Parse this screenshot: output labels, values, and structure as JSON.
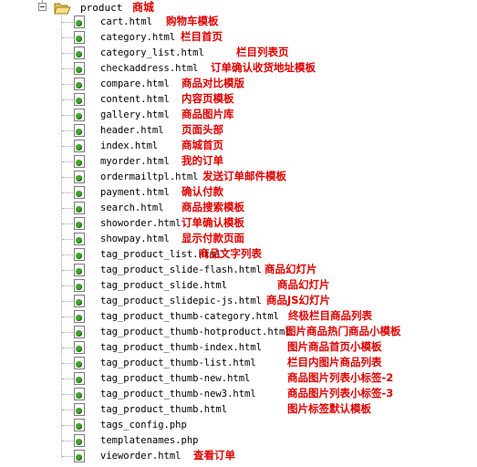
{
  "root": {
    "name": "product",
    "desc": "商城",
    "icon": "folder-open-icon",
    "toggle": "minus"
  },
  "colors": {
    "desc": "#e00000",
    "name": "#000000"
  },
  "files": [
    {
      "name": "cart.html",
      "desc": "购物车模板"
    },
    {
      "name": "category.html",
      "desc": "栏目首页"
    },
    {
      "name": "category_list.html",
      "desc": "栏目列表页"
    },
    {
      "name": "checkaddress.html",
      "desc": "订单确认收货地址模板"
    },
    {
      "name": "compare.html",
      "desc": "商品对比模版"
    },
    {
      "name": "content.html",
      "desc": "内容页模板"
    },
    {
      "name": "gallery.html",
      "desc": "商品图片库"
    },
    {
      "name": "header.html",
      "desc": "页面头部"
    },
    {
      "name": "index.html",
      "desc": "商城首页"
    },
    {
      "name": "myorder.html",
      "desc": "我的订单"
    },
    {
      "name": "ordermailtpl.html",
      "desc": "发送订单邮件模板"
    },
    {
      "name": "payment.html",
      "desc": "确认付款"
    },
    {
      "name": "search.html",
      "desc": "商品搜索模板"
    },
    {
      "name": "showorder.html",
      "desc": "订单确认模板"
    },
    {
      "name": "showpay.html",
      "desc": "显示付款页面"
    },
    {
      "name": "tag_product_list.html",
      "desc": "商品文字列表"
    },
    {
      "name": "tag_product_slide-flash.html",
      "desc": "商品幻灯片"
    },
    {
      "name": "tag_product_slide.html",
      "desc": "商品幻灯片"
    },
    {
      "name": "tag_product_slidepic-js.html",
      "desc": "商品JS幻灯片"
    },
    {
      "name": "tag_product_thumb-category.html",
      "desc": "终极栏目商品列表"
    },
    {
      "name": "tag_product_thumb-hotproduct.html",
      "desc": "图片商品热门商品小模板"
    },
    {
      "name": "tag_product_thumb-index.html",
      "desc": "图片商品首页小模板"
    },
    {
      "name": "tag_product_thumb-list.html",
      "desc": "栏目内图片商品列表"
    },
    {
      "name": "tag_product_thumb-new.html",
      "desc": "商品图片列表小标签-2"
    },
    {
      "name": "tag_product_thumb-new3.html",
      "desc": "商品图片列表小标签-3"
    },
    {
      "name": "tag_product_thumb.html",
      "desc": "图片标签默认模板"
    },
    {
      "name": "tags_config.php",
      "desc": ""
    },
    {
      "name": "templatenames.php",
      "desc": ""
    },
    {
      "name": "vieworder.html",
      "desc": "查看订单"
    }
  ]
}
